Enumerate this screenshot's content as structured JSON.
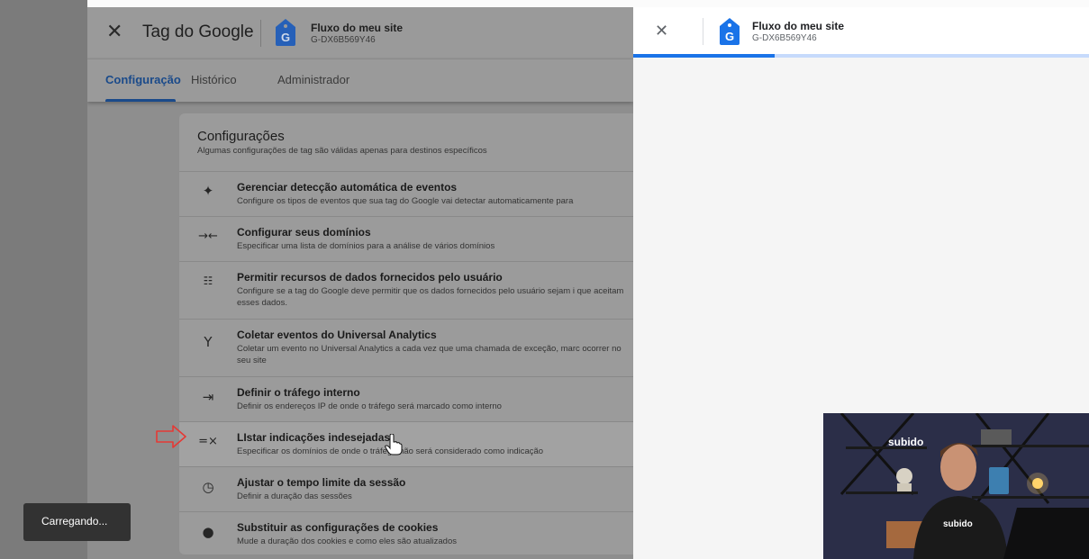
{
  "main_panel": {
    "title": "Tag do Google",
    "property_name": "Fluxo do meu site",
    "property_id": "G-DX6B569Y46",
    "tabs": [
      {
        "label": "Configuração",
        "active": true
      },
      {
        "label": "Histórico",
        "active": false
      },
      {
        "label": "Administrador",
        "active": false
      }
    ]
  },
  "settings": {
    "title": "Configurações",
    "subtitle": "Algumas configurações de tag são válidas apenas para destinos específicos",
    "items": [
      {
        "icon": "sparkle-icon",
        "title": "Gerenciar detecção automática de eventos",
        "desc": "Configure os tipos de eventos que sua tag do Google vai detectar automaticamente para"
      },
      {
        "icon": "cross-domain-icon",
        "title": "Configurar seus domínios",
        "desc": "Especificar uma lista de domínios para a análise de vários domínios"
      },
      {
        "icon": "user-data-icon",
        "title": "Permitir recursos de dados fornecidos pelo usuário",
        "desc": "Configure se a tag do Google deve permitir que os dados fornecidos pelo usuário sejam i que aceitam esses dados."
      },
      {
        "icon": "merge-icon",
        "title": "Coletar eventos do Universal Analytics",
        "desc": "Coletar um evento no Universal Analytics a cada vez que uma chamada de exceção, marc ocorrer no seu site"
      },
      {
        "icon": "login-icon",
        "title": "Definir o tráfego interno",
        "desc": "Definir os endereços IP de onde o tráfego será marcado como interno"
      },
      {
        "icon": "list-remove-icon",
        "title": "LIstar indicações indesejadas",
        "desc": "Especificar os domínios de onde o tráfego não será considerado como indicação"
      },
      {
        "icon": "clock-icon",
        "title": "Ajustar o tempo limite da sessão",
        "desc": "Definir a duração das sessões"
      },
      {
        "icon": "cookie-icon",
        "title": "Substituir as configurações de cookies",
        "desc": "Mude a duração dos cookies e como eles são atualizados"
      }
    ]
  },
  "right_panel": {
    "property_name": "Fluxo do meu site",
    "property_id": "G-DX6B569Y46",
    "progress_percent": 31
  },
  "snackbar": {
    "text": "Carregando..."
  },
  "webcam": {
    "sign": "subido",
    "shirt": "subido"
  },
  "colors": {
    "accent": "#1a73e8",
    "tag_blue": "#1a73e8",
    "annotation_arrow": "#e53935"
  }
}
